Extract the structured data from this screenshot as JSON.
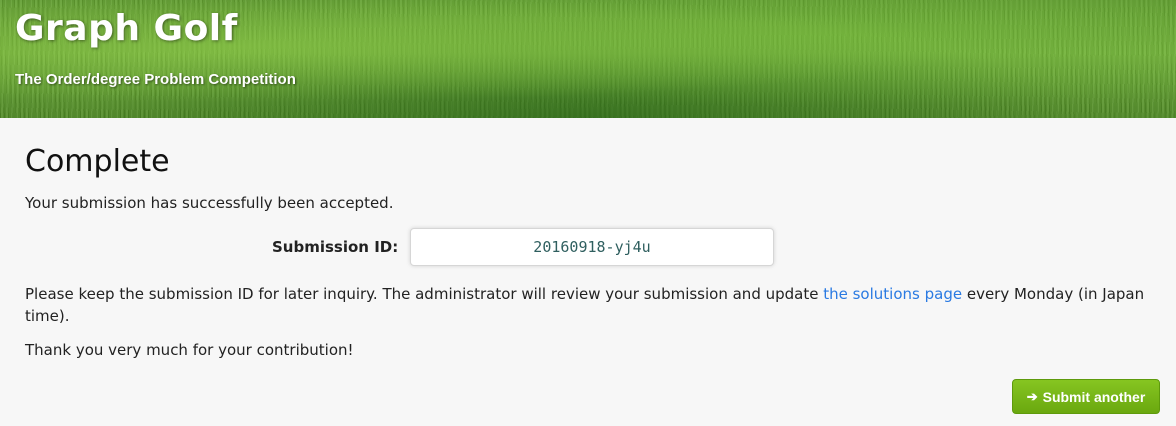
{
  "header": {
    "title": "Graph Golf",
    "subtitle": "The Order/degree Problem Competition"
  },
  "main": {
    "heading": "Complete",
    "accepted_message": "Your submission has successfully been accepted.",
    "submission_id_label": "Submission ID:",
    "submission_id_value": "20160918-yj4u",
    "info_text_before": "Please keep the submission ID for later inquiry. The administrator will review your submission and update ",
    "info_link": "the solutions page",
    "info_text_after": " every Monday (in Japan time).",
    "thanks": "Thank you very much for your contribution!",
    "submit_another_label": "Submit another",
    "submit_another_icon": "arrow-right-icon"
  },
  "colors": {
    "link": "#2a7ae2",
    "button": "#74b41a"
  }
}
